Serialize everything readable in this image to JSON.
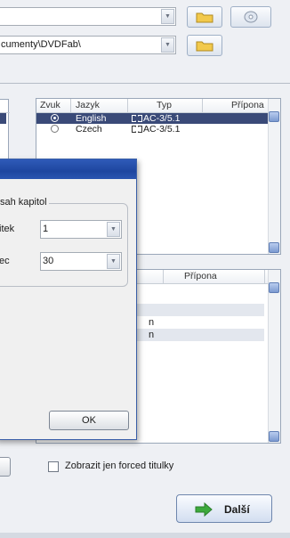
{
  "top": {
    "path_value": "cumenty\\DVDFab\\"
  },
  "audio": {
    "headers": {
      "zvuk": "Zvuk",
      "jazyk": "Jazyk",
      "typ": "Typ",
      "pripona": "Přípona"
    },
    "rows": [
      {
        "language": "English",
        "type": "AC-3/5.1",
        "selected": true
      },
      {
        "language": "Czech",
        "type": "AC-3/5.1",
        "selected": false
      }
    ]
  },
  "subs": {
    "headers": {
      "pripona": "Přípona"
    },
    "rows": [
      "",
      "n",
      "n"
    ]
  },
  "dialog": {
    "group_label": "sah kapitol",
    "field1_label": "itek",
    "field1_value": "1",
    "field2_label": "ec",
    "field2_value": "30",
    "ok_label": "OK"
  },
  "footer": {
    "forced_label": "Zobrazit jen forced titulky",
    "next_label": "Další"
  },
  "colors": {
    "selection": "#3a4a78",
    "titlebar": "#2a55b0",
    "next_arrow": "#3caa3c",
    "folder": "#f2c94c"
  }
}
